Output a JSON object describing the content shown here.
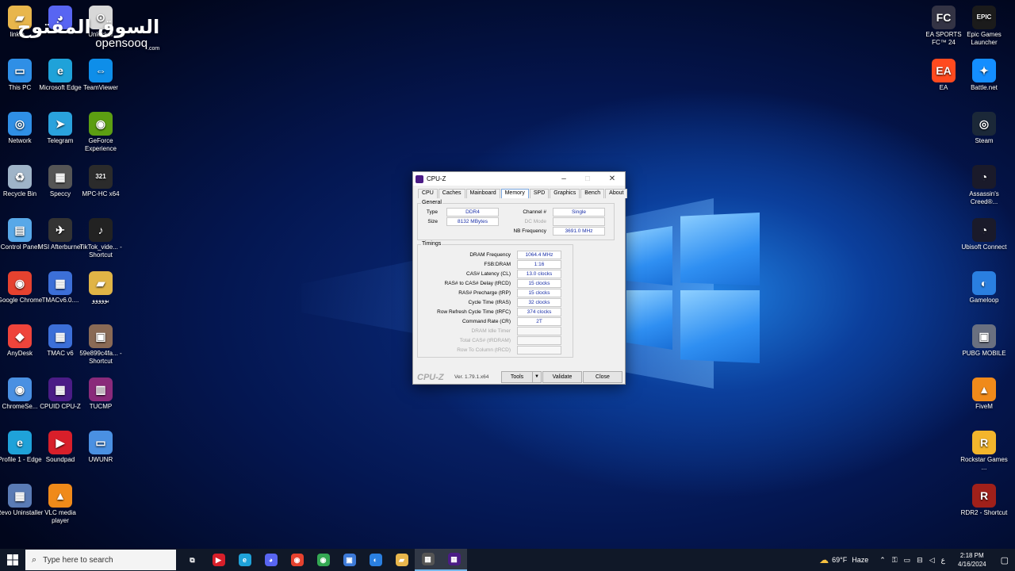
{
  "watermark": {
    "arabic": "السوق المفتوح",
    "latin": "opensooq",
    "suffix": ".com"
  },
  "desktop_left": [
    {
      "label": "linkin...",
      "icon": "folder-icon",
      "color": "#e8b64c",
      "glyph": "▰"
    },
    {
      "label": "",
      "icon": "discord-icon",
      "color": "#5865f2",
      "glyph": "◕"
    },
    {
      "label": "Unlocker",
      "icon": "unlocker-icon",
      "color": "#d8d8d8",
      "glyph": "⊙"
    },
    {
      "label": "This PC",
      "icon": "this-pc-icon",
      "color": "#2f8fe6",
      "glyph": "▭"
    },
    {
      "label": "Microsoft Edge",
      "icon": "edge-icon",
      "color": "#1fa2d9",
      "glyph": "e"
    },
    {
      "label": "TeamViewer",
      "icon": "teamviewer-icon",
      "color": "#0e8ee9",
      "glyph": "⇔"
    },
    {
      "label": "Network",
      "icon": "network-icon",
      "color": "#2f8fe6",
      "glyph": "◎"
    },
    {
      "label": "Telegram",
      "icon": "telegram-icon",
      "color": "#2aa2dd",
      "glyph": "➤"
    },
    {
      "label": "GeForce Experience",
      "icon": "geforce-icon",
      "color": "#5c9e12",
      "glyph": "◉"
    },
    {
      "label": "Recycle Bin",
      "icon": "recycle-bin-icon",
      "color": "#9fb4c8",
      "glyph": "♻"
    },
    {
      "label": "Speccy",
      "icon": "speccy-icon",
      "color": "#555",
      "glyph": "▦"
    },
    {
      "label": "MPC-HC x64",
      "icon": "mpc-hc-icon",
      "color": "#2b2b2b",
      "glyph": "321"
    },
    {
      "label": "Control Panel",
      "icon": "control-panel-icon",
      "color": "#58a8e8",
      "glyph": "▤"
    },
    {
      "label": "MSI Afterburner",
      "icon": "msi-afterburner-icon",
      "color": "#333",
      "glyph": "✈"
    },
    {
      "label": "TikTok_vide... - Shortcut",
      "icon": "tiktok-shortcut-icon",
      "color": "#222",
      "glyph": "♪"
    },
    {
      "label": "Google Chrome",
      "icon": "chrome-icon",
      "color": "#e6422f",
      "glyph": "◉"
    },
    {
      "label": "TMACv6.0....",
      "icon": "tmac-icon",
      "color": "#3c6fd8",
      "glyph": "▦"
    },
    {
      "label": "بووووو",
      "icon": "folder-icon",
      "color": "#e0b446",
      "glyph": "▰"
    },
    {
      "label": "AnyDesk",
      "icon": "anydesk-icon",
      "color": "#ef443b",
      "glyph": "◆"
    },
    {
      "label": "TMAC v6",
      "icon": "tmac-v6-icon",
      "color": "#3c6fd8",
      "glyph": "▦"
    },
    {
      "label": "59e899c4fa... - Shortcut",
      "icon": "image-shortcut-icon",
      "color": "#8a6a55",
      "glyph": "▣"
    },
    {
      "label": "ChromeSe...",
      "icon": "chromesetup-icon",
      "color": "#4a90e2",
      "glyph": "◉"
    },
    {
      "label": "CPUID CPU-Z",
      "icon": "cpuz-icon",
      "color": "#4b1c86",
      "glyph": "▦"
    },
    {
      "label": "TUCMP",
      "icon": "winrar-icon",
      "color": "#8a2a7a",
      "glyph": "▥"
    },
    {
      "label": "Profile 1 - Edge",
      "icon": "edge-profile-icon",
      "color": "#1fa2d9",
      "glyph": "e"
    },
    {
      "label": "Soundpad",
      "icon": "soundpad-icon",
      "color": "#d81f2a",
      "glyph": "▶"
    },
    {
      "label": "UWUNR",
      "icon": "uwunr-icon",
      "color": "#4a90e2",
      "glyph": "▭"
    },
    {
      "label": "Revo Uninstaller",
      "icon": "revo-icon",
      "color": "#5a7bb5",
      "glyph": "▦"
    },
    {
      "label": "VLC media player",
      "icon": "vlc-icon",
      "color": "#f08a1a",
      "glyph": "▲"
    }
  ],
  "desktop_right": [
    {
      "label": "EA SPORTS FC™ 24",
      "icon": "ea-fc24-icon",
      "color": "#334",
      "glyph": "FC"
    },
    {
      "label": "Epic Games Launcher",
      "icon": "epic-games-icon",
      "color": "#1b1b1b",
      "glyph": "EPIC"
    },
    {
      "label": "EA",
      "icon": "ea-icon",
      "color": "#ff4a1f",
      "glyph": "EA"
    },
    {
      "label": "Battle.net",
      "icon": "battlenet-icon",
      "color": "#148eff",
      "glyph": "✦"
    },
    {
      "label": "Steam",
      "icon": "steam-icon",
      "color": "#1b2838",
      "glyph": "◎"
    },
    {
      "label": "Assassin's Creed®...",
      "icon": "ubisoft-icon",
      "color": "#1a1a2a",
      "glyph": "◔"
    },
    {
      "label": "Ubisoft Connect",
      "icon": "ubisoft-connect-icon",
      "color": "#1a1a2a",
      "glyph": "◔"
    },
    {
      "label": "Gameloop",
      "icon": "gameloop-icon",
      "color": "#2a7fe0",
      "glyph": "◐"
    },
    {
      "label": "PUBG MOBILE",
      "icon": "pubg-icon",
      "color": "#6a7080",
      "glyph": "▣"
    },
    {
      "label": "FiveM",
      "icon": "fivem-icon",
      "color": "#f08a1a",
      "glyph": "▲"
    },
    {
      "label": "Rockstar Games ...",
      "icon": "rockstar-icon",
      "color": "#f3b52c",
      "glyph": "R"
    },
    {
      "label": "RDR2 - Shortcut",
      "icon": "rdr2-icon",
      "color": "#a0201a",
      "glyph": "R"
    }
  ],
  "cpuz": {
    "title": "CPU-Z",
    "window_controls": {
      "minimize": "–",
      "maximize": "☐",
      "close": "✕"
    },
    "tabs": [
      "CPU",
      "Caches",
      "Mainboard",
      "Memory",
      "SPD",
      "Graphics",
      "Bench",
      "About"
    ],
    "general": {
      "label": "General",
      "type_label": "Type",
      "type_value": "DDR4",
      "size_label": "Size",
      "size_value": "8132 MBytes",
      "channel_label": "Channel #",
      "channel_value": "Single",
      "dcmode_label": "DC Mode",
      "dcmode_value": "",
      "nbfreq_label": "NB Frequency",
      "nbfreq_value": "3691.0 MHz"
    },
    "timings": {
      "label": "Timings",
      "rows": [
        {
          "label": "DRAM Frequency",
          "value": "1064.4 MHz",
          "dim": false
        },
        {
          "label": "FSB:DRAM",
          "value": "1:16",
          "dim": false
        },
        {
          "label": "CAS# Latency (CL)",
          "value": "13.0 clocks",
          "dim": false
        },
        {
          "label": "RAS# to CAS# Delay (tRCD)",
          "value": "15 clocks",
          "dim": false
        },
        {
          "label": "RAS# Precharge (tRP)",
          "value": "15 clocks",
          "dim": false
        },
        {
          "label": "Cycle Time (tRAS)",
          "value": "32 clocks",
          "dim": false
        },
        {
          "label": "Row Refresh Cycle Time (tRFC)",
          "value": "374 clocks",
          "dim": false
        },
        {
          "label": "Command Rate (CR)",
          "value": "2T",
          "dim": false
        },
        {
          "label": "DRAM Idle Timer",
          "value": "",
          "dim": true
        },
        {
          "label": "Total CAS# (tRDRAM)",
          "value": "",
          "dim": true
        },
        {
          "label": "Row To Column (tRCD)",
          "value": "",
          "dim": true
        }
      ]
    },
    "footer": {
      "logo": "CPU-Z",
      "version": "Ver. 1.79.1.x64",
      "tools": "Tools",
      "tools_arrow": "▼",
      "validate": "Validate",
      "close": "Close"
    }
  },
  "taskbar": {
    "search_placeholder": "Type here to search",
    "apps": [
      {
        "icon": "task-view-icon",
        "color": "transparent",
        "glyph": "⧉",
        "running": false
      },
      {
        "icon": "soundpad-task-icon",
        "color": "#d81f2a",
        "glyph": "▶",
        "running": false
      },
      {
        "icon": "edge-task-icon",
        "color": "#1fa2d9",
        "glyph": "e",
        "running": false
      },
      {
        "icon": "discord-task-icon",
        "color": "#5865f2",
        "glyph": "◕",
        "running": false
      },
      {
        "icon": "chrome-task-icon",
        "color": "#e6422f",
        "glyph": "◉",
        "running": false
      },
      {
        "icon": "chrome-profile-task-icon",
        "color": "#34a853",
        "glyph": "◉",
        "running": false
      },
      {
        "icon": "photos-task-icon",
        "color": "#3d7ad8",
        "glyph": "▣",
        "running": false
      },
      {
        "icon": "gameloop-task-icon",
        "color": "#2a7fe0",
        "glyph": "◐",
        "running": false
      },
      {
        "icon": "file-explorer-task-icon",
        "color": "#e8b64c",
        "glyph": "▰",
        "running": false
      },
      {
        "icon": "speccy-task-icon",
        "color": "#555",
        "glyph": "▦",
        "running": true
      },
      {
        "icon": "cpuz-task-icon",
        "color": "#4b1c86",
        "glyph": "▦",
        "running": true
      }
    ],
    "weather_temp": "69°F",
    "weather_text": "Haze",
    "lang": "ع",
    "time": "2:18 PM",
    "date": "4/16/2024"
  }
}
